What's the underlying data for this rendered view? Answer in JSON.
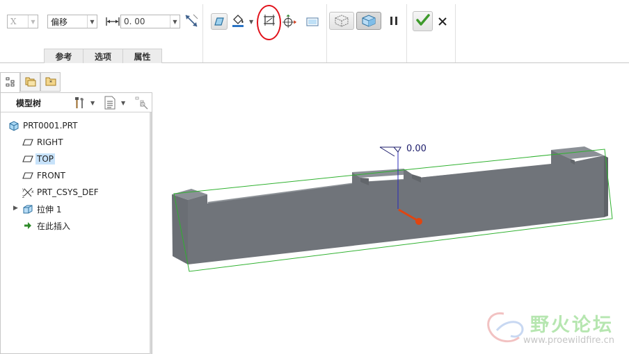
{
  "ribbon": {
    "direction_value": "X",
    "type_value": "偏移",
    "offset_value": "0. 00",
    "tabs": [
      "参考",
      "选项",
      "属性"
    ]
  },
  "navigator": {
    "title": "模型树",
    "items": [
      {
        "label": "PRT0001.PRT",
        "icon": "part-icon"
      },
      {
        "label": "RIGHT",
        "icon": "datum-plane-icon"
      },
      {
        "label": "TOP",
        "icon": "datum-plane-icon",
        "selected": true
      },
      {
        "label": "FRONT",
        "icon": "datum-plane-icon"
      },
      {
        "label": "PRT_CSYS_DEF",
        "icon": "csys-icon"
      },
      {
        "label": "拉伸 1",
        "icon": "extrude-icon"
      },
      {
        "label": "在此插入",
        "icon": "insert-here-icon"
      }
    ]
  },
  "graphics": {
    "dimension_value": "0.00"
  },
  "watermark": {
    "text": "野火论坛",
    "url": "www.proewildfire.cn"
  },
  "colors": {
    "model": "#6f7379",
    "plane_outline": "#2fb12f",
    "drag_handle": "#e04510",
    "highlight": "#e1121b",
    "selection": "#c7e2fa"
  }
}
